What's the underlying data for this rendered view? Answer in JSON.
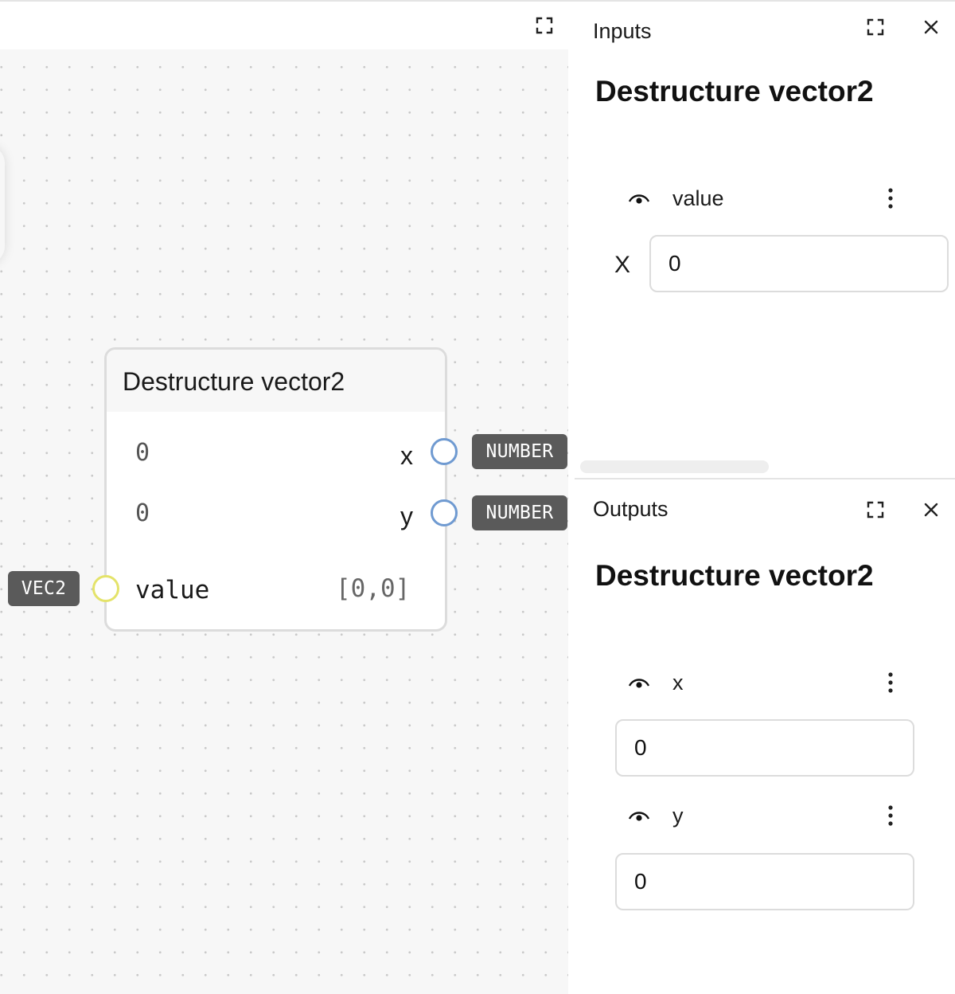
{
  "node": {
    "title": "Destructure vector2",
    "outputs": [
      {
        "value": "0",
        "label": "x",
        "type": "NUMBER"
      },
      {
        "value": "0",
        "label": "y",
        "type": "NUMBER"
      }
    ],
    "input": {
      "type": "VEC2",
      "label": "value",
      "value": "[0,0]"
    }
  },
  "inputs_panel": {
    "tab_label": "Inputs",
    "title": "Destructure vector2",
    "field_name": "value",
    "axis_label": "X",
    "x_value": "0"
  },
  "outputs_panel": {
    "tab_label": "Outputs",
    "title": "Destructure vector2",
    "fields": [
      {
        "name": "x",
        "value": "0"
      },
      {
        "name": "y",
        "value": "0"
      }
    ]
  },
  "icons": {
    "fullscreen": "fullscreen-icon",
    "close": "close-icon",
    "visibility": "eye-icon",
    "more": "kebab-menu-icon"
  },
  "colors": {
    "port_number": "#6f9ad1",
    "port_vec2": "#e4e36a",
    "badge_bg": "#5a5a5a",
    "canvas_bg": "#f7f7f7"
  }
}
